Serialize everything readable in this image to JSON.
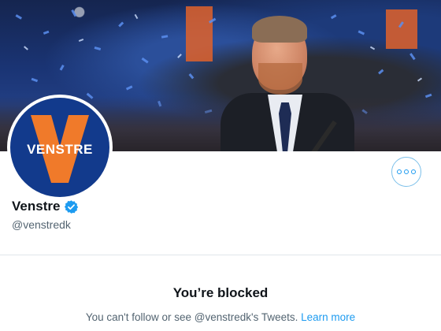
{
  "profile": {
    "logo_text": "VENSTRE",
    "display_name": "Venstre",
    "handle": "@venstredk",
    "verified": true
  },
  "blocked": {
    "title": "You’re blocked",
    "description": "You can't follow or see @venstredk's Tweets.",
    "learn_more": "Learn more"
  },
  "colors": {
    "accent": "#1d9bf0",
    "logo_blue": "#123a8c",
    "logo_orange": "#f07a2a",
    "text_primary": "#0f1419",
    "text_secondary": "#536471"
  },
  "icons": {
    "more": "more-icon",
    "verified": "verified-badge-icon"
  }
}
